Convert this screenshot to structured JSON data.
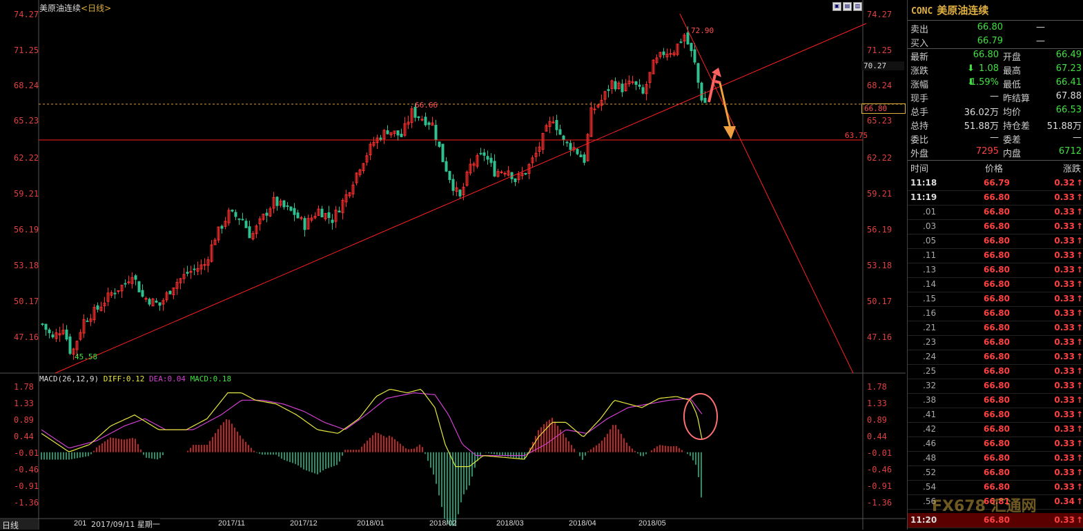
{
  "chart_title": "美原油连续",
  "chart_period": "<日线>",
  "window_buttons": [
    "▣",
    "▤",
    "▥"
  ],
  "price_axis_labels": [
    "74.27",
    "71.25",
    "68.24",
    "65.23",
    "62.22",
    "59.21",
    "56.19",
    "53.18",
    "50.17",
    "47.16"
  ],
  "macd_axis_labels": [
    "1.78",
    "1.33",
    "0.89",
    "0.44",
    "-0.01",
    "-0.46",
    "-0.91",
    "-1.36"
  ],
  "price_annotations": {
    "high": "72.90",
    "low": "45.58",
    "mid_high": "66.66",
    "support": "63.75",
    "current": "66.80",
    "crosshair": "70.27"
  },
  "macd_legend": {
    "name": "MACD(26,12,9)",
    "diff": "DIFF:0.12",
    "dea": "DEA:0.04",
    "macd": "MACD:0.18"
  },
  "period_tab": "日线",
  "crosshair_date": "2017/09/11 星期一",
  "x_axis_labels": [
    "201",
    "2017/11",
    "2017/12",
    "2018/01",
    "2018/02",
    "2018/03",
    "2018/04",
    "2018/05"
  ],
  "colors": {
    "up": "#ff3030",
    "down": "#30c090",
    "diff": "#e8e840",
    "dea": "#d040d0",
    "trend": "#ff2020",
    "arrow_up": "#ff6060",
    "arrow_down": "#f0a040"
  },
  "quote": {
    "code": "CONC",
    "name": "美原油连续",
    "sell": {
      "label": "卖出",
      "price": "66.80",
      "vol": "—"
    },
    "buy": {
      "label": "买入",
      "price": "66.79",
      "vol": "—"
    },
    "rows": [
      {
        "l1": "最新",
        "v1": "66.80",
        "l2": "开盘",
        "v2": "66.49"
      },
      {
        "l1": "涨跌",
        "v1": "1.08",
        "l2": "最高",
        "v2": "67.23"
      },
      {
        "l1": "涨幅",
        "v1": "1.59%",
        "l2": "最低",
        "v2": "66.41"
      },
      {
        "l1": "现手",
        "v1": "—",
        "l2": "昨结算",
        "v2": "67.88"
      },
      {
        "l1": "总手",
        "v1": "36.02万",
        "l2": "均价",
        "v2": "66.53"
      },
      {
        "l1": "总持",
        "v1": "51.88万",
        "l2": "持仓差",
        "v2": "51.88万"
      },
      {
        "l1": "委比",
        "v1": "—",
        "l2": "委差",
        "v2": "—"
      },
      {
        "l1": "外盘",
        "v1": "7295",
        "l2": "内盘",
        "v2": "6712"
      }
    ],
    "tick_header": {
      "time": "时间",
      "price": "价格",
      "chg": "涨跌"
    },
    "ticks": [
      {
        "t": "11:18",
        "p": "66.79",
        "c": "0.32"
      },
      {
        "t": "11:19",
        "p": "66.80",
        "c": "0.33"
      },
      {
        "t": ".01",
        "p": "66.80",
        "c": "0.33"
      },
      {
        "t": ".03",
        "p": "66.80",
        "c": "0.33"
      },
      {
        "t": ".05",
        "p": "66.80",
        "c": "0.33"
      },
      {
        "t": ".11",
        "p": "66.80",
        "c": "0.33"
      },
      {
        "t": ".13",
        "p": "66.80",
        "c": "0.33"
      },
      {
        "t": ".14",
        "p": "66.80",
        "c": "0.33"
      },
      {
        "t": ".15",
        "p": "66.80",
        "c": "0.33"
      },
      {
        "t": ".16",
        "p": "66.80",
        "c": "0.33"
      },
      {
        "t": ".21",
        "p": "66.80",
        "c": "0.33"
      },
      {
        "t": ".23",
        "p": "66.80",
        "c": "0.33"
      },
      {
        "t": ".24",
        "p": "66.80",
        "c": "0.33"
      },
      {
        "t": ".25",
        "p": "66.80",
        "c": "0.33"
      },
      {
        "t": ".32",
        "p": "66.80",
        "c": "0.33"
      },
      {
        "t": ".38",
        "p": "66.80",
        "c": "0.33"
      },
      {
        "t": ".41",
        "p": "66.80",
        "c": "0.33"
      },
      {
        "t": ".42",
        "p": "66.80",
        "c": "0.33"
      },
      {
        "t": ".46",
        "p": "66.80",
        "c": "0.33"
      },
      {
        "t": ".48",
        "p": "66.80",
        "c": "0.33"
      },
      {
        "t": ".52",
        "p": "66.80",
        "c": "0.33"
      },
      {
        "t": ".54",
        "p": "66.80",
        "c": "0.33"
      },
      {
        "t": ".56",
        "p": "66.81",
        "c": "0.34"
      },
      {
        "t": "11:20",
        "p": "66.80",
        "c": "0.33"
      }
    ]
  },
  "watermark": "FX678 汇通网"
}
